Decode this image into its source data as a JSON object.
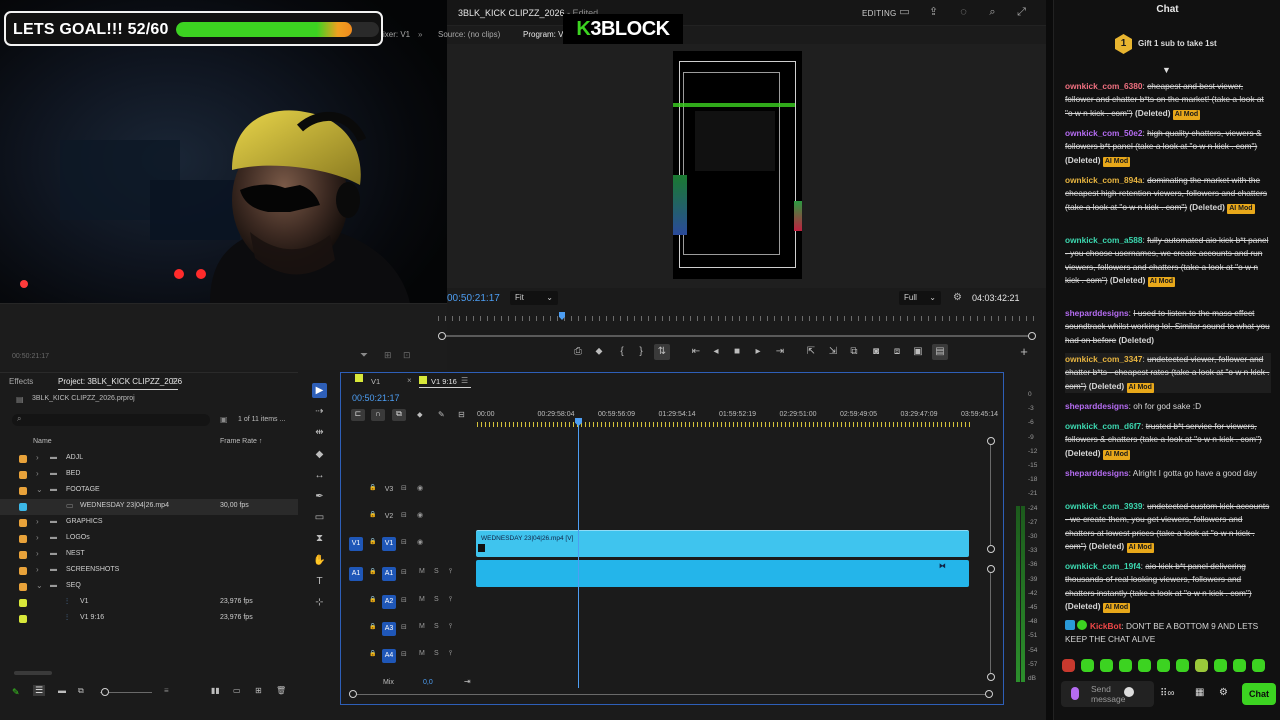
{
  "topbar": {
    "title": "3BLK_KICK CLIPZZ_2026",
    "title_suffix": " - Edited",
    "workspace": "EDITING"
  },
  "overlay": {
    "goal_text": "LETS GOAL!!! 52/60",
    "goal_current": 52,
    "goal_target": 60,
    "logo_k": "K",
    "logo_rest": "3BLOCK"
  },
  "program": {
    "tab_mixer": "ixer: V1",
    "tab_source": "Source: (no clips)",
    "tab_program": "Program: V1",
    "timecode": "00:50:21:17",
    "fit": "Fit",
    "quality": "Full",
    "duration": "04:03:42:21"
  },
  "source_panel": {
    "timecode": "00:50:21:17"
  },
  "project": {
    "tab_effects": "Effects",
    "tab_project": "Project: 3BLK_KICK CLIPZZ_2026",
    "file": "3BLK_KICK CLIPZZ_2026.prproj",
    "count": "1 of 11 items ...",
    "col_name": "Name",
    "col_frame_rate": "Frame Rate",
    "rows": [
      {
        "name": "ADJL",
        "color": "#e8a23a",
        "kind": "folder",
        "fps": ""
      },
      {
        "name": "BED",
        "color": "#e8a23a",
        "kind": "folder",
        "fps": ""
      },
      {
        "name": "FOOTAGE",
        "color": "#e8a23a",
        "kind": "folder-open",
        "fps": ""
      },
      {
        "name": "WEDNESDAY 23|04|26.mp4",
        "color": "#3cb8e8",
        "kind": "clip",
        "fps": "30,00 fps"
      },
      {
        "name": "GRAPHICS",
        "color": "#e8a23a",
        "kind": "folder",
        "fps": ""
      },
      {
        "name": "LOGOs",
        "color": "#e8a23a",
        "kind": "folder",
        "fps": ""
      },
      {
        "name": "NEST",
        "color": "#e8a23a",
        "kind": "folder",
        "fps": ""
      },
      {
        "name": "SCREENSHOTS",
        "color": "#e8a23a",
        "kind": "folder",
        "fps": ""
      },
      {
        "name": "SEQ",
        "color": "#e8a23a",
        "kind": "folder-open",
        "fps": ""
      },
      {
        "name": "V1",
        "color": "#d8e83a",
        "kind": "seq",
        "fps": "23,976 fps"
      },
      {
        "name": "V1 9:16",
        "color": "#d8e83a",
        "kind": "seq",
        "fps": "23,976 fps"
      }
    ]
  },
  "timeline": {
    "tab1": "V1",
    "tab2": "V1 9:16",
    "timecode": "00:50:21:17",
    "ruler": [
      "00:00",
      "00:29:58:04",
      "00:59:56:09",
      "01:29:54:14",
      "01:59:52:19",
      "02:29:51:00",
      "02:59:49:05",
      "03:29:47:09",
      "03:59:45:14"
    ],
    "clip_label": "WEDNESDAY 23|04|26.mp4 [V]",
    "mix_label": "Mix",
    "mix_value": "0,0",
    "tracks": [
      {
        "name": "V3"
      },
      {
        "name": "V2"
      },
      {
        "name": "V1"
      },
      {
        "name": "A1"
      },
      {
        "name": "A2"
      },
      {
        "name": "A3"
      },
      {
        "name": "A4"
      }
    ]
  },
  "meter": {
    "scale": [
      "0",
      "-3",
      "-6",
      "-9",
      "-12",
      "-15",
      "-18",
      "-21",
      "-24",
      "-27",
      "-30",
      "-33",
      "-36",
      "-39",
      "-42",
      "-45",
      "-48",
      "-51",
      "-54",
      "-57",
      "dB"
    ]
  },
  "chat": {
    "header": "Chat",
    "gift_rank": "1",
    "gift_text": "Gift 1 sub to take 1st",
    "messages": [
      {
        "user": "ownkick_com_6380",
        "color": "#f07080",
        "text": "cheapest and best viewer, follower and chatter b*ts on the market! (take a look at \"o w n kick . com\")",
        "deleted": true,
        "aimod": true
      },
      {
        "user": "ownkick_com_50e2",
        "color": "#b56cf2",
        "text": "high quality chatters, viewers & followers b*t panel (take a look at \"o w n kick . com\")",
        "deleted": true,
        "aimod": true
      },
      {
        "user": "ownkick_com_894a",
        "color": "#e8b540",
        "text": "dominating the market with the cheapest high retention viewers, followers and chatters (take a look at \"o w n kick . com\")",
        "deleted": true,
        "aimod": true
      },
      {
        "user": "ownkick_com_a588",
        "color": "#3cd8b0",
        "text": "fully automated aio kick b*t panel - you choose usernames, we create accounts and run viewers, followers and chatters (take a look at \"o w n kick . com\")",
        "deleted": true,
        "aimod": true
      },
      {
        "user": "sheparddesigns",
        "color": "#b56cf2",
        "text": "I used to listen to the mass effect soundtrack whilst working lol. Similar sound to what you had on before",
        "deleted": true,
        "aimod": false
      },
      {
        "user": "ownkick_com_3347",
        "color": "#e8b540",
        "text": "undetected viewer, follower and chatter b*ts - cheapest rates (take a look at \"o w n kick . com\")",
        "deleted": true,
        "aimod": true
      },
      {
        "user": "sheparddesigns",
        "color": "#b56cf2",
        "text": "oh for god sake :D",
        "deleted": false,
        "aimod": false
      },
      {
        "user": "ownkick_com_d6f7",
        "color": "#3cd8b0",
        "text": "trusted b*t service for viewers, followers & chatters (take a look at \"o w n kick . com\")",
        "deleted": true,
        "aimod": true
      },
      {
        "user": "sheparddesigns",
        "color": "#b56cf2",
        "text": "Alright I gotta go have a good day",
        "deleted": false,
        "aimod": false
      },
      {
        "user": "ownkick_com_3939",
        "color": "#3cd8b0",
        "text": "undetected custom kick accounts - we create them, you get viewers, followers and chatters at lowest prices (take a look at \"o w n kick . com\")",
        "deleted": true,
        "aimod": true
      },
      {
        "user": "ownkick_com_19f4",
        "color": "#3cd8b0",
        "text": "aio kick b*t panel delivering thousands of real looking viewers, followers and chatters instantly (take a look at \"o w n kick . com\")",
        "deleted": true,
        "aimod": true
      }
    ],
    "deleted_tag": "(Deleted)",
    "aimod_tag": "AI Mod",
    "bot_user": "KickBot",
    "bot_text": "DON'T BE A BOTTOM 9 AND LETS KEEP THE CHAT ALIVE",
    "send_placeholder": "Send message",
    "chat_button": "Chat"
  }
}
